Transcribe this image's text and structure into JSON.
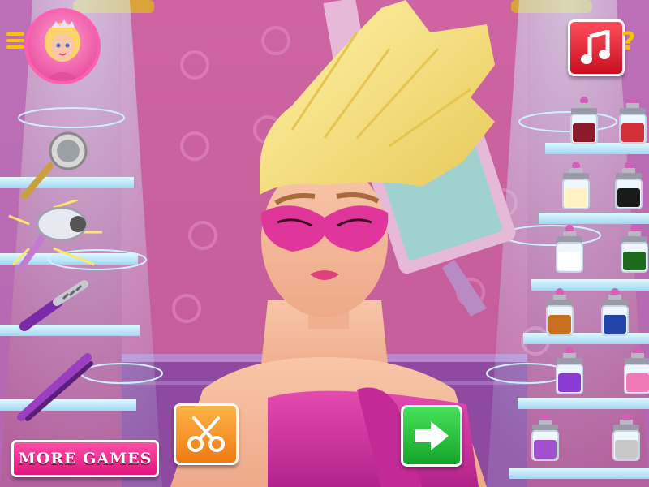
{
  "buttons": {
    "more_games_label": "MORE GAMES"
  },
  "icons": {
    "menu": "menu-icon",
    "avatar": "princess-avatar",
    "music": "music-note-icon",
    "help": "question-mark-icon",
    "scissors": "scissors-icon",
    "next": "arrow-right-icon"
  },
  "help_symbol": "?",
  "tools": [
    "hair-washer",
    "hair-dryer",
    "curling-iron",
    "hair-straightener"
  ],
  "jar_colors": [
    [
      "#8b1a2a",
      "#d3303a"
    ],
    [
      "#fff1c2",
      "#1a1a1a"
    ],
    [
      "#ffffff",
      "#1d6a1e"
    ],
    [
      "#c8701c",
      "#2243a8"
    ],
    [
      "#8b3ad4",
      "#f07ab8"
    ],
    [
      "#a24fd0",
      "#c8c8c8"
    ]
  ],
  "colors": {
    "more_games": "#e0157a",
    "scissors_button": "#f07a12",
    "next_button": "#14a52a",
    "music_button": "#c8101f"
  }
}
